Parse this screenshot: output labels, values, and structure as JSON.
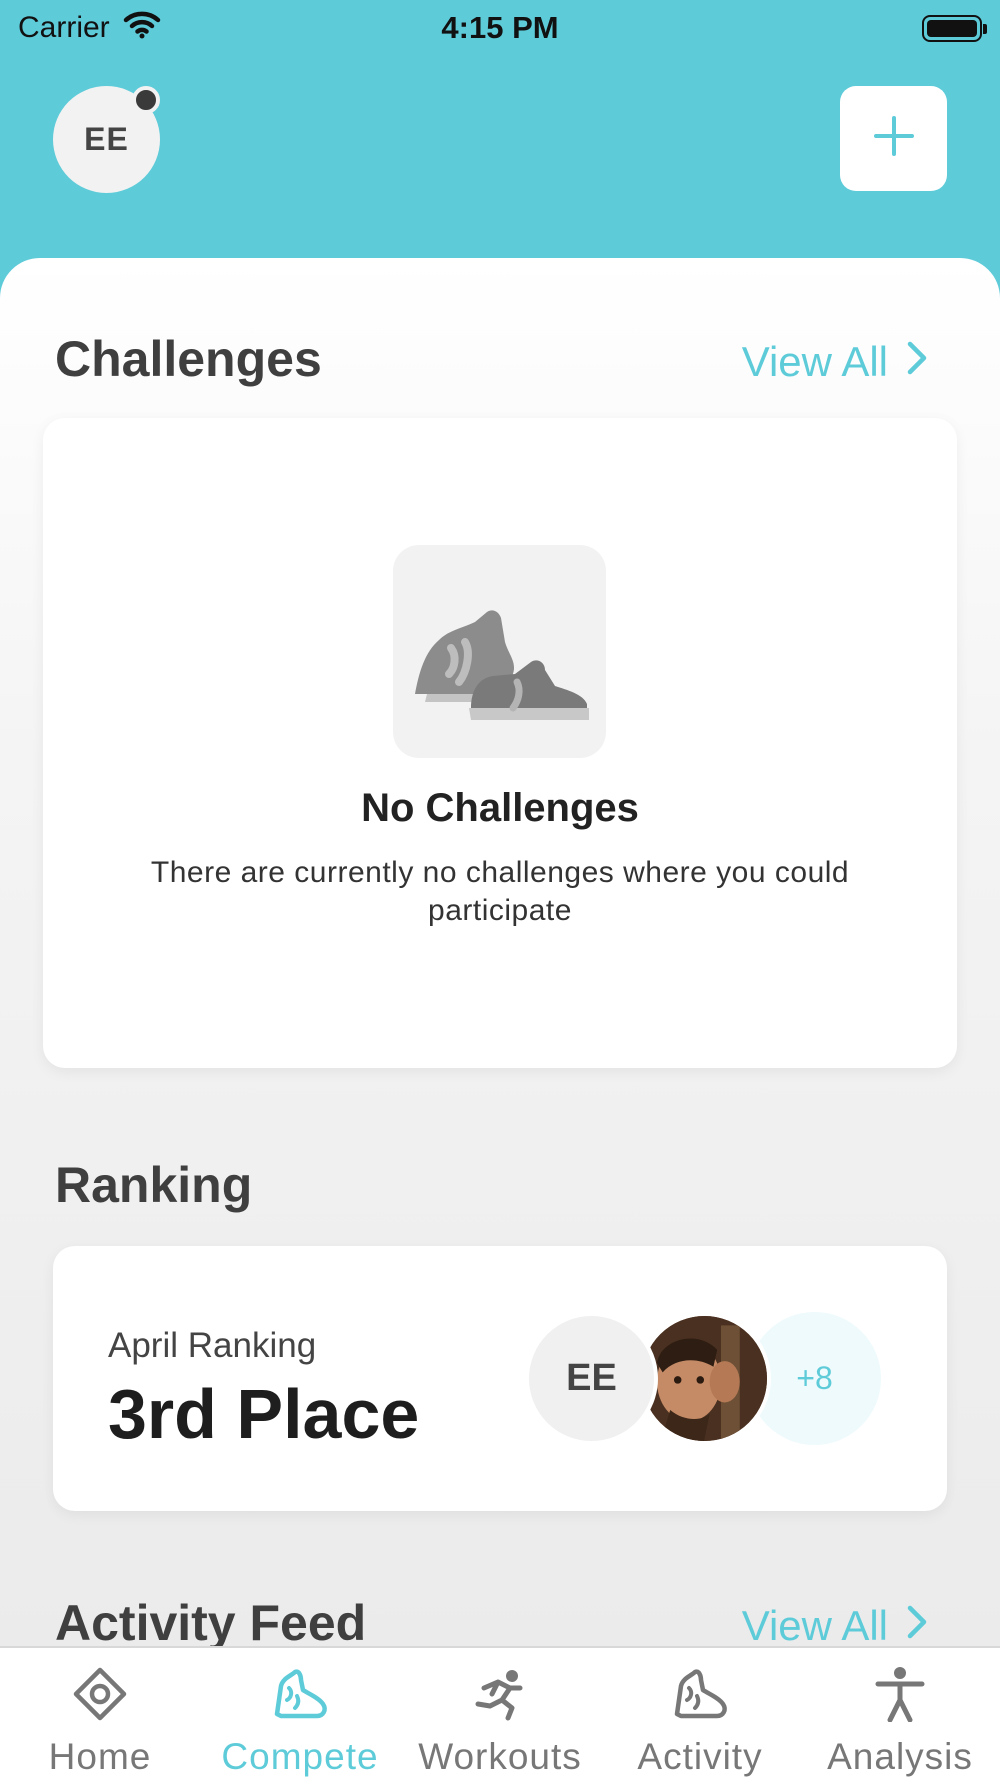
{
  "status_bar": {
    "carrier": "Carrier",
    "time": "4:15 PM"
  },
  "header": {
    "avatar_initials": "EE"
  },
  "challenges": {
    "title": "Challenges",
    "view_all": "View All",
    "empty_title": "No Challenges",
    "empty_text": "There are currently no challenges where you could participate"
  },
  "ranking": {
    "title": "Ranking",
    "label": "April Ranking",
    "place": "3rd Place",
    "avatar_initials": "EE",
    "more_count": "+8"
  },
  "activity_feed": {
    "title": "Activity Feed",
    "view_all": "View All"
  },
  "tabs": [
    {
      "label": "Home",
      "icon": "home-icon",
      "active": false
    },
    {
      "label": "Compete",
      "icon": "sneaker-icon",
      "active": true
    },
    {
      "label": "Workouts",
      "icon": "runner-icon",
      "active": false
    },
    {
      "label": "Activity",
      "icon": "sneaker-outline-icon",
      "active": false
    },
    {
      "label": "Analysis",
      "icon": "person-icon",
      "active": false
    }
  ],
  "colors": {
    "accent": "#5ecbd9",
    "header_bg": "#5ecbd9",
    "text_dark": "#3f3f3f"
  }
}
